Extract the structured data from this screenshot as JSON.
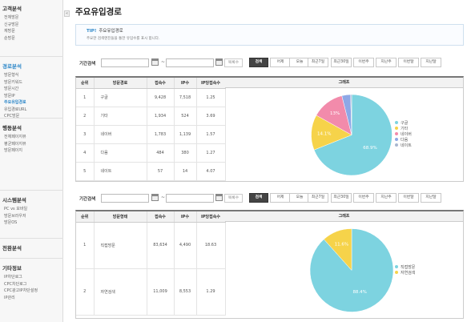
{
  "sidebar": {
    "sections": [
      {
        "title": "고객분석",
        "items": [
          "전체방문",
          "신규방문",
          "재방문",
          "순방문"
        ]
      },
      {
        "title": "경로분석",
        "items": [
          "방문형식",
          "방문키워드",
          "방문시간",
          "방문IP",
          "주요유입경로",
          "유입경로URL",
          "CPC방문"
        ]
      },
      {
        "title": "행동분석",
        "items": [
          "전체페이지뷰",
          "평균페이지뷰",
          "방문페이지"
        ]
      },
      {
        "title": "시스템분석",
        "items": [
          "PC vs 모바일",
          "방문브라우저",
          "방문OS"
        ]
      },
      {
        "title": "전환분석",
        "items": []
      },
      {
        "title": "기타정보",
        "items": [
          "IP차단로그",
          "CPC차단로그",
          "CPC광고IP차단설정",
          "IP관리"
        ]
      }
    ],
    "collapse_glyph": "«"
  },
  "page": {
    "title": "주요유입경로"
  },
  "tip": {
    "label": "TIP!",
    "title": "주요유입경로",
    "body": "주요한 검색엔진들을 통한 유입수를 표시 합니다."
  },
  "search": {
    "label": "기간검색",
    "tilde": "~",
    "clear": "목록수",
    "buttons": [
      "검색",
      "어제",
      "오늘",
      "최근7일",
      "최근30일",
      "이번주",
      "지난주",
      "이번달",
      "지난달"
    ]
  },
  "table1": {
    "headers": [
      "순위",
      "방문경로",
      "접속수",
      "IP수",
      "IP당접속수",
      "그래프"
    ],
    "rows": [
      [
        "1",
        "구글",
        "9,428",
        "7,518",
        "1.25"
      ],
      [
        "2",
        "기타",
        "1,934",
        "524",
        "3.69"
      ],
      [
        "3",
        "네이버",
        "1,783",
        "1,139",
        "1.57"
      ],
      [
        "4",
        "다음",
        "484",
        "380",
        "1.27"
      ],
      [
        "5",
        "네이트",
        "57",
        "14",
        "4.07"
      ]
    ]
  },
  "table2": {
    "headers": [
      "순위",
      "방문형태",
      "접속수",
      "IP수",
      "IP당접속수",
      "그래프"
    ],
    "rows": [
      [
        "1",
        "직접방문",
        "83,634",
        "4,490",
        "18.63"
      ],
      [
        "2",
        "자연검색",
        "11,009",
        "8,553",
        "1.29"
      ]
    ]
  },
  "chart_data": [
    {
      "type": "pie",
      "categories": [
        "구글",
        "기타",
        "네이버",
        "다음",
        "네이트"
      ],
      "values": [
        68.9,
        14.1,
        13.0,
        3.5,
        0.4
      ],
      "labels": [
        "68.9%",
        "14.1%",
        "13%",
        "",
        ""
      ],
      "colors": [
        "#7dd3e0",
        "#f6d34a",
        "#f28bab",
        "#8ea8e6",
        "#a9b7d0"
      ],
      "legend": "right"
    },
    {
      "type": "pie",
      "categories": [
        "직접방문",
        "자연검색"
      ],
      "values": [
        88.4,
        11.6
      ],
      "labels": [
        "88.4%",
        "11.6%"
      ],
      "colors": [
        "#7dd3e0",
        "#f6d34a"
      ],
      "legend": "right"
    }
  ]
}
